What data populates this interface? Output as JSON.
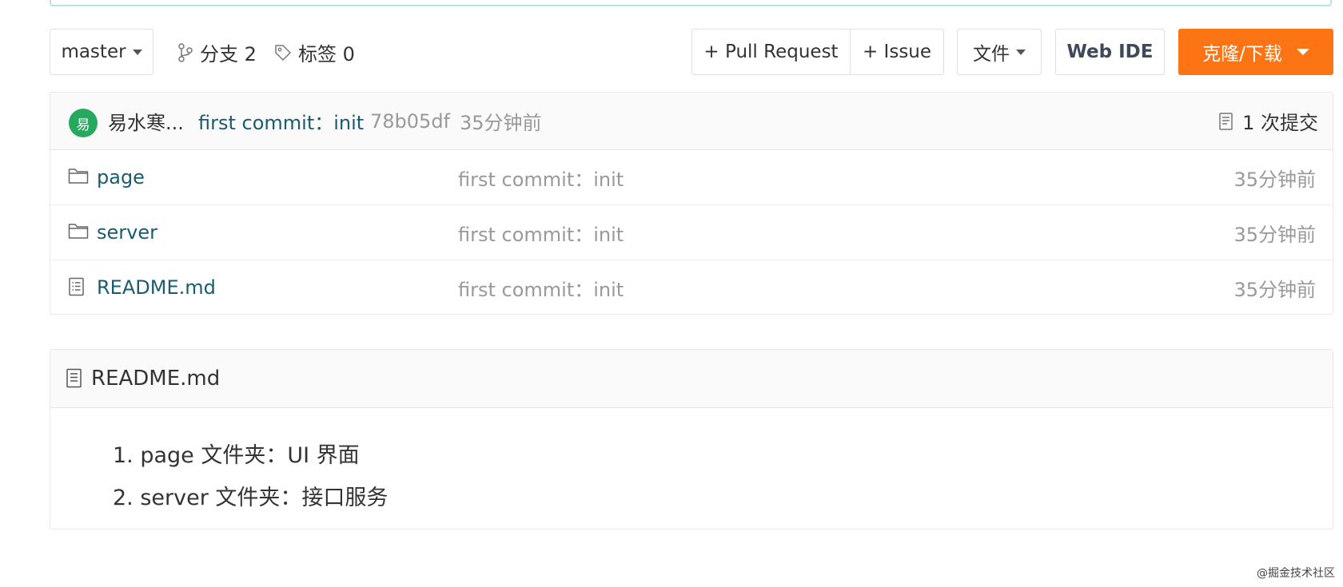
{
  "toolbar": {
    "branch": "master",
    "branches_label": "分支 2",
    "tags_label": "标签 0",
    "pull_request_label": "+ Pull Request",
    "issue_label": "+ Issue",
    "file_label": "文件",
    "web_ide_label": "Web IDE",
    "clone_label": "克隆/下载"
  },
  "commit": {
    "avatar_letter": "易",
    "author": "易水寒...",
    "message": "first commit：init",
    "sha": "78b05df",
    "time": "35分钟前",
    "count_label": "1 次提交"
  },
  "files": [
    {
      "name": "page",
      "type": "folder",
      "message": "first commit：init",
      "time": "35分钟前"
    },
    {
      "name": "server",
      "type": "folder",
      "message": "first commit：init",
      "time": "35分钟前"
    },
    {
      "name": "README.md",
      "type": "file",
      "message": "first commit：init",
      "time": "35分钟前"
    }
  ],
  "readme": {
    "title": "README.md",
    "items": [
      "1. page 文件夹：UI 界面",
      "2. server 文件夹：接口服务"
    ]
  },
  "watermark": "@掘金技术社区",
  "colors": {
    "accent_orange": "#fd7414",
    "link_teal": "#1a5c6e",
    "avatar_green": "#26a95f"
  }
}
